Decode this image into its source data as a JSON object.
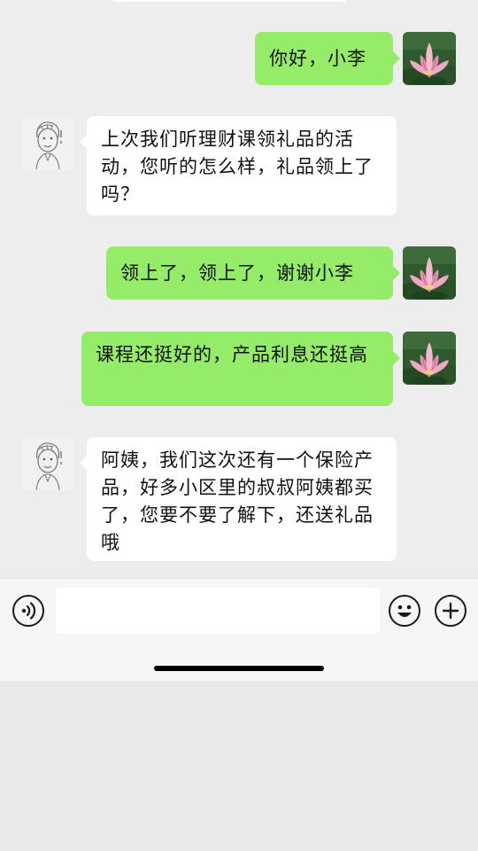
{
  "messages": [
    {
      "side": "right",
      "text": "你好，小李",
      "avatar": "lotus-avatar"
    },
    {
      "side": "left",
      "text": "上次我们听理财课领礼品的活动，您听的怎么样，礼品领上了吗？",
      "avatar": "sketch-avatar"
    },
    {
      "side": "right",
      "text": "领上了，领上了，谢谢小李",
      "avatar": "lotus-avatar"
    },
    {
      "side": "right",
      "text": "课程还挺好的，产品利息还挺高",
      "avatar": "lotus-avatar"
    },
    {
      "side": "left",
      "text": "阿姨，我们这次还有一个保险产品，好多小区里的叔叔阿姨都买了，您要不要了解下，还送礼品哦",
      "avatar": "sketch-avatar"
    }
  ],
  "input_bar": {
    "voice_icon": "voice-icon",
    "emoji_icon": "emoji-icon",
    "add_icon": "plus-icon",
    "text_value": ""
  },
  "colors": {
    "sent_bubble": "#95ec69",
    "received_bubble": "#ffffff",
    "background": "#ededed"
  }
}
